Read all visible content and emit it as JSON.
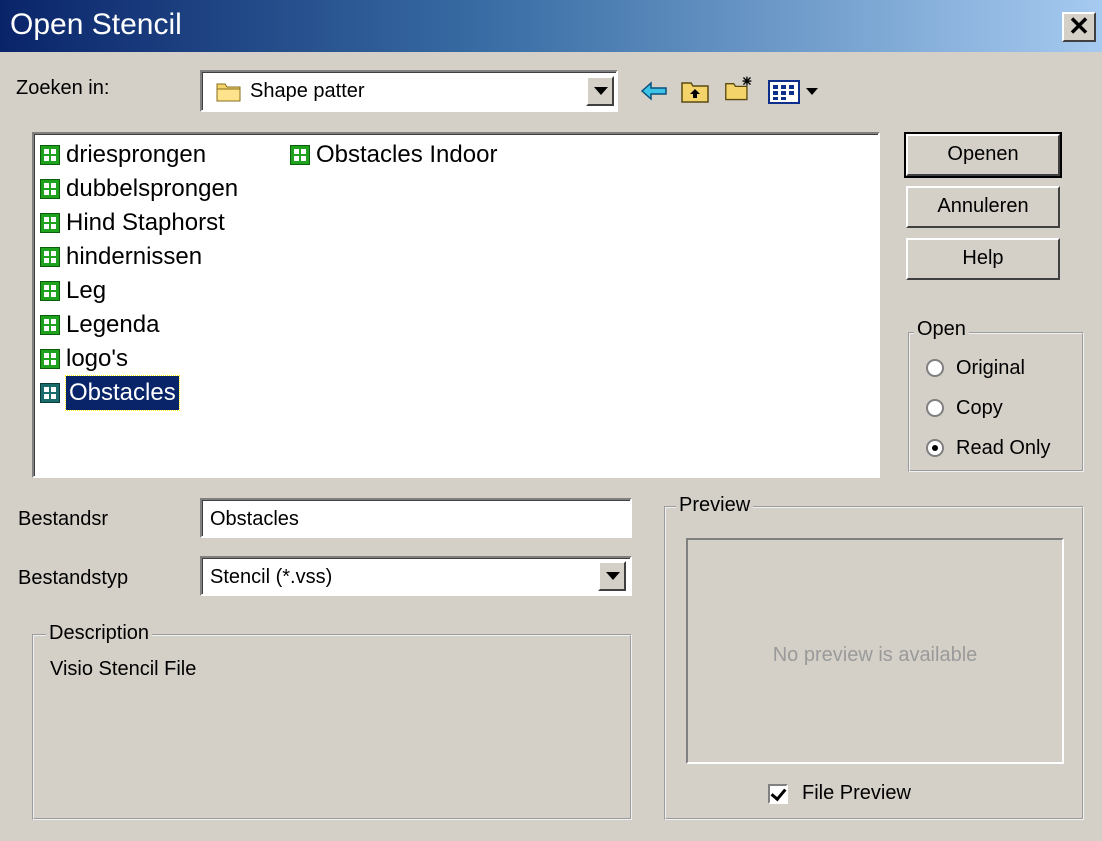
{
  "window": {
    "title": "Open Stencil",
    "close_glyph": "✕"
  },
  "look_in": {
    "label": "Zoeken in:",
    "value": "Shape patter",
    "icon": "folder-icon"
  },
  "toolbar": {
    "icons": [
      "back-arrow-icon",
      "up-folder-icon",
      "new-folder-icon",
      "view-menu-icon"
    ]
  },
  "file_list": {
    "items": [
      {
        "name": "driesprongen",
        "selected": false
      },
      {
        "name": "dubbelsprongen",
        "selected": false
      },
      {
        "name": "Hind Staphorst",
        "selected": false
      },
      {
        "name": "hindernissen",
        "selected": false
      },
      {
        "name": "Leg",
        "selected": false
      },
      {
        "name": "Legenda",
        "selected": false
      },
      {
        "name": "logo's",
        "selected": false
      },
      {
        "name": "Obstacles",
        "selected": true
      },
      {
        "name": "Obstacles Indoor",
        "selected": false
      }
    ]
  },
  "buttons": {
    "open": "Openen",
    "cancel": "Annuleren",
    "help": "Help"
  },
  "open_mode": {
    "label": "Open",
    "options": [
      {
        "label": "Original",
        "checked": false
      },
      {
        "label": "Copy",
        "checked": false
      },
      {
        "label": "Read Only",
        "checked": true
      }
    ]
  },
  "filename": {
    "label": "Bestandsr",
    "value": "Obstacles"
  },
  "filetype": {
    "label": "Bestandstyp",
    "value": "Stencil (*.vss)"
  },
  "description": {
    "label": "Description",
    "text": "Visio Stencil File"
  },
  "preview": {
    "label": "Preview",
    "message": "No preview is available",
    "file_preview_label": "File Preview",
    "file_preview_checked": true
  },
  "colors": {
    "face": "#d4d0c8",
    "selection": "#0a246a",
    "title_start": "#0a246a",
    "title_end": "#a6caf0"
  }
}
